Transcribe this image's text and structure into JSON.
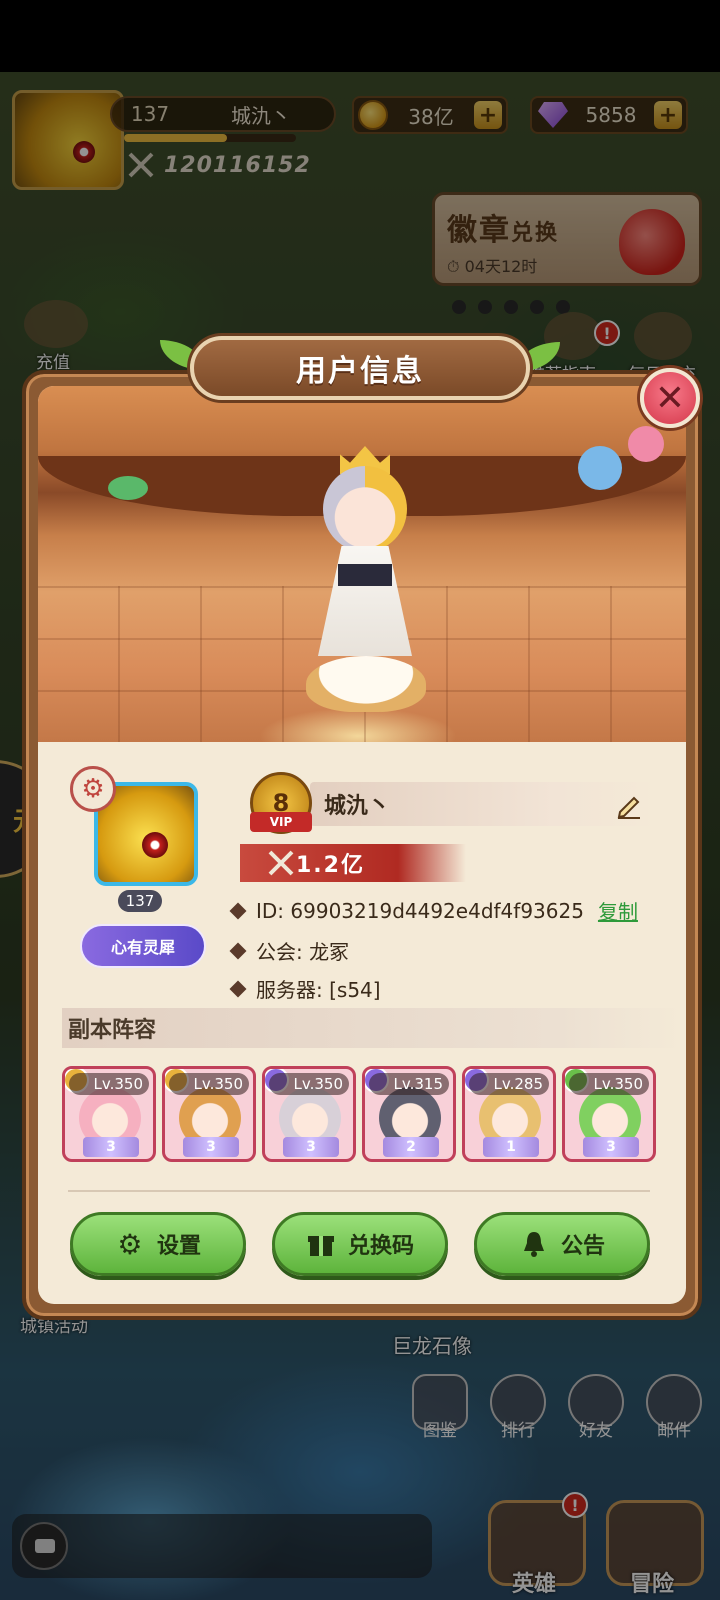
{
  "hud": {
    "player_level": "137",
    "player_name": "城氿丶",
    "xp_fraction": 0.6,
    "combat_power": "120116152",
    "gold": "38亿",
    "gems": "5858",
    "badge_exchange": {
      "title_main": "徽章",
      "title_sub": "兑换",
      "timer": "04天12时"
    },
    "side_labels": {
      "recharge": "充值",
      "guide": "推荐指南",
      "first_charge": "每日首充",
      "event": "城镇活动"
    },
    "promo_text": "元"
  },
  "modal": {
    "title": "用户信息",
    "close_icon": "close-icon",
    "profile": {
      "level": "137",
      "title_badge": "心有灵犀",
      "vip_level": "8",
      "vip_label": "VIP",
      "name": "城氿丶",
      "power": "1.2亿",
      "id_line": "ID: 69903219d4492e4df4f93625",
      "copy_label": "复制",
      "guild_line": "公会: 龙冢",
      "server_line": "服务器: [s54]"
    },
    "lineup_title": "副本阵容",
    "heroes": [
      {
        "level": "Lv.350",
        "stars": "3",
        "element_color": "#e8b23c",
        "face_color": "#f6b0c0"
      },
      {
        "level": "Lv.350",
        "stars": "3",
        "element_color": "#e8b23c",
        "face_color": "#e0a050"
      },
      {
        "level": "Lv.350",
        "stars": "3",
        "element_color": "#8a6ae0",
        "face_color": "#d8d0d8"
      },
      {
        "level": "Lv.315",
        "stars": "2",
        "element_color": "#8a6ae0",
        "face_color": "#606070"
      },
      {
        "level": "Lv.285",
        "stars": "1",
        "element_color": "#8a6ae0",
        "face_color": "#e8c070"
      },
      {
        "level": "Lv.350",
        "stars": "3",
        "element_color": "#6ac04a",
        "face_color": "#80d060"
      }
    ],
    "buttons": {
      "settings": "设置",
      "redeem": "兑换码",
      "notice": "公告"
    }
  },
  "bottom": {
    "handbook": "图鉴",
    "ranking": "排行",
    "friends": "好友",
    "mail": "邮件",
    "heroes": "英雄",
    "adventure": "冒险",
    "map_label": "巨龙石像"
  },
  "colors": {
    "accent_green": "#5eb43c",
    "vip_red": "#c32a28",
    "frame_brown": "#8b5a33"
  }
}
